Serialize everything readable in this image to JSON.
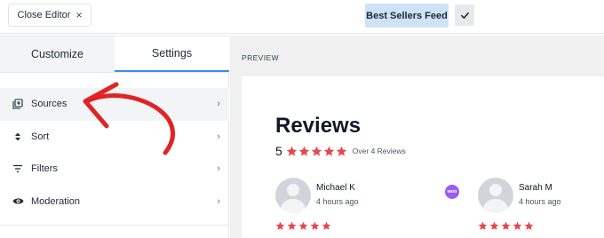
{
  "topbar": {
    "close_label": "Close Editor",
    "close_icon": "×",
    "feed_name": "Best Sellers Feed",
    "confirm_icon": "check-icon"
  },
  "sidebar": {
    "tabs": [
      {
        "label": "Customize",
        "active": false
      },
      {
        "label": "Settings",
        "active": true
      }
    ],
    "items": [
      {
        "label": "Sources",
        "icon": "sources-icon",
        "active": true
      },
      {
        "label": "Sort",
        "icon": "sort-icon",
        "active": false
      },
      {
        "label": "Filters",
        "icon": "filter-icon",
        "active": false
      },
      {
        "label": "Moderation",
        "icon": "eye-icon",
        "active": false
      }
    ],
    "chevron": "›"
  },
  "preview": {
    "label": "PREVIEW",
    "title": "Reviews",
    "rating_value": "5",
    "rating_stars": 5,
    "rating_count_text": "Over 4 Reviews",
    "reviews": [
      {
        "name": "Michael K",
        "time": "4 hours ago",
        "stars": 5
      },
      {
        "name": "Sarah M",
        "time": "4 hours ago",
        "stars": 5
      }
    ],
    "badge_text": "woo"
  },
  "colors": {
    "star": "#e5484d",
    "tab_underline": "#3a8ee6",
    "feed_badge_bg": "#cfe3f6",
    "woo_badge": "#9b5cf1",
    "arrow": "#e02424"
  }
}
